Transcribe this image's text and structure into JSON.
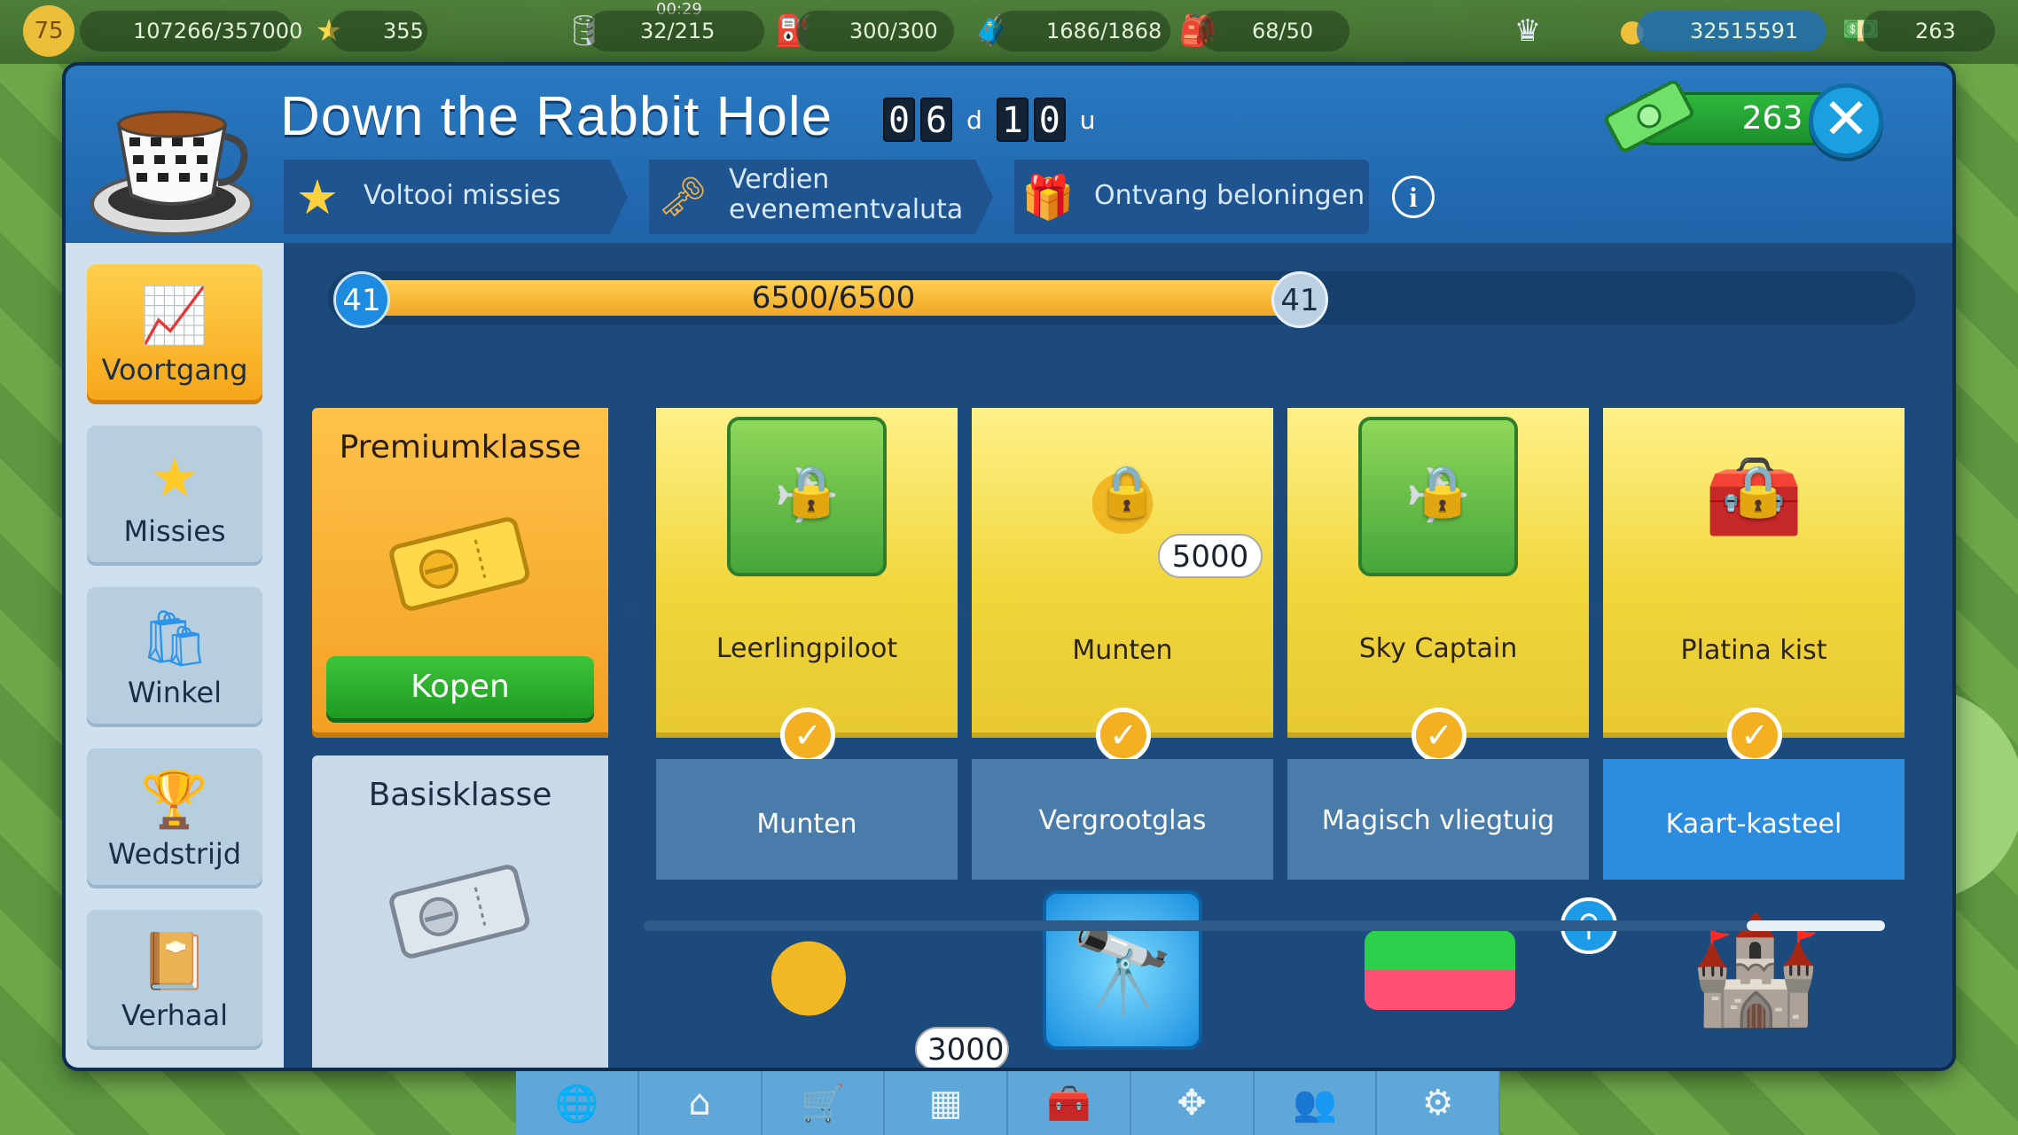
{
  "hud": {
    "level": "75",
    "xp": "107266/357000",
    "stars": "355",
    "time": "00:29",
    "fuel": "32/215",
    "jerrycan": "300/300",
    "bags": "1686/1868",
    "backpack": "68/50",
    "coins": "32515591",
    "cash": "263"
  },
  "dialog": {
    "title": "Down the Rabbit Hole",
    "timer": {
      "d1": "0",
      "d2": "6",
      "unit_d": "d",
      "h1": "1",
      "h2": "0",
      "unit_h": "u"
    },
    "steps": [
      "Voltooi missies",
      "Verdien evenementvaluta",
      "Ontvang beloningen"
    ],
    "info": "i",
    "cash": "263",
    "close": "✕"
  },
  "nav": [
    "Voortgang",
    "Missies",
    "Winkel",
    "Wedstrijd",
    "Verhaal"
  ],
  "progress": {
    "level_left": "41",
    "level_right": "41",
    "text": "6500/6500",
    "fraction": 1.0
  },
  "premium": {
    "label": "Premiumklasse",
    "buy": "Kopen"
  },
  "basic": {
    "label": "Basisklasse"
  },
  "premium_rewards": [
    {
      "label": "Leerlingpiloot"
    },
    {
      "label": "Munten",
      "qty": "5000"
    },
    {
      "label": "Sky Captain"
    },
    {
      "label": "Platina kist"
    }
  ],
  "basic_rewards": [
    {
      "label": "Munten",
      "qty": "3000"
    },
    {
      "label": "Vergrootglas"
    },
    {
      "label": "Magisch vliegtuig"
    },
    {
      "label": "Kaart-kasteel"
    }
  ],
  "colors": {
    "accent": "#f3a024",
    "header": "#2a79c2",
    "panel": "#1c4a7c",
    "green": "#1f9a23"
  }
}
